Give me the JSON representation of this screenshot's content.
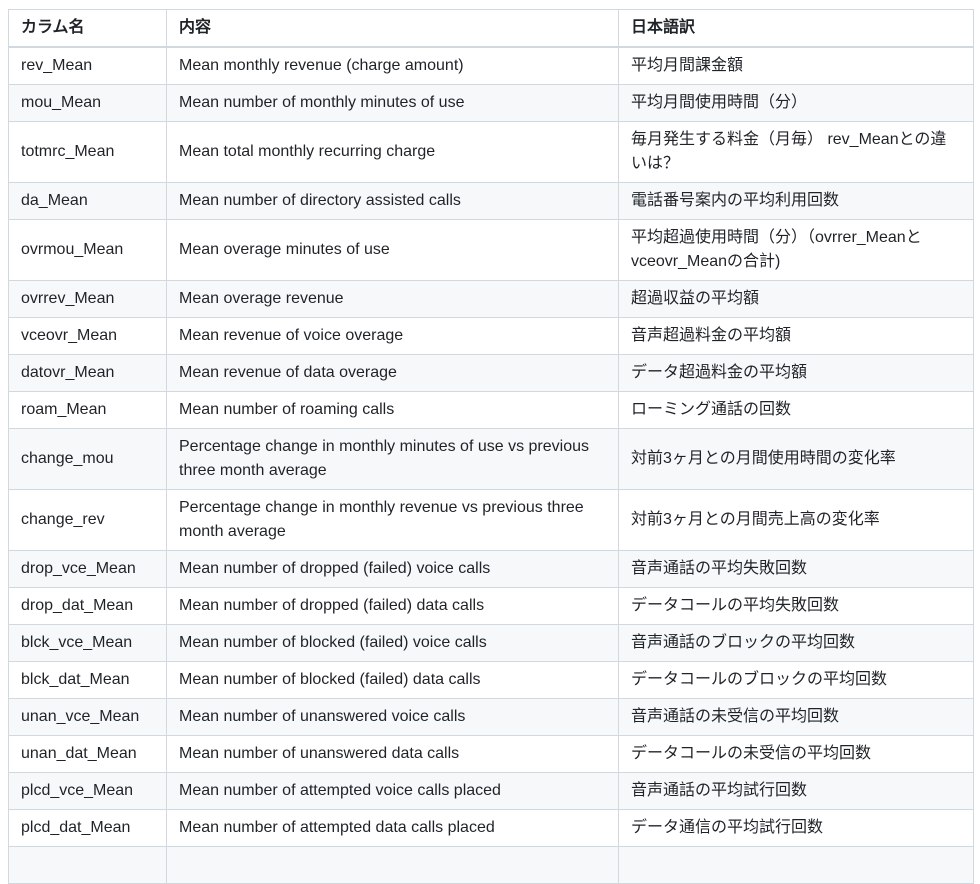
{
  "table": {
    "headers": [
      "カラム名",
      "内容",
      "日本語訳"
    ],
    "rows": [
      [
        "rev_Mean",
        "Mean monthly revenue (charge amount)",
        "平均月間課金額"
      ],
      [
        "mou_Mean",
        "Mean number of monthly minutes of use",
        "平均月間使用時間（分）"
      ],
      [
        "totmrc_Mean",
        "Mean total monthly recurring charge",
        "毎月発生する料金（月毎） rev_Meanとの違いは？"
      ],
      [
        "da_Mean",
        "Mean number of directory assisted calls",
        "電話番号案内の平均利用回数"
      ],
      [
        "ovrmou_Mean",
        "Mean overage minutes of use",
        "平均超過使用時間（分）（ovrrer_Meanとvceovr_Meanの合計)"
      ],
      [
        "ovrrev_Mean",
        "Mean overage revenue",
        "超過収益の平均額"
      ],
      [
        "vceovr_Mean",
        "Mean revenue of voice overage",
        "音声超過料金の平均額"
      ],
      [
        "datovr_Mean",
        "Mean revenue of data overage",
        "データ超過料金の平均額"
      ],
      [
        "roam_Mean",
        "Mean number of roaming calls",
        "ローミング通話の回数"
      ],
      [
        "change_mou",
        "Percentage change in monthly minutes of use vs previous three month average",
        "対前3ヶ月との月間使用時間の変化率"
      ],
      [
        "change_rev",
        "Percentage change in monthly revenue vs previous three month average",
        "対前3ヶ月との月間売上高の変化率"
      ],
      [
        "drop_vce_Mean",
        "Mean number of dropped (failed) voice calls",
        "音声通話の平均失敗回数"
      ],
      [
        "drop_dat_Mean",
        "Mean number of dropped (failed) data calls",
        "データコールの平均失敗回数"
      ],
      [
        "blck_vce_Mean",
        "Mean number of blocked (failed) voice calls",
        "音声通話のブロックの平均回数"
      ],
      [
        "blck_dat_Mean",
        "Mean number of blocked (failed) data calls",
        "データコールのブロックの平均回数"
      ],
      [
        "unan_vce_Mean",
        "Mean number of unanswered voice calls",
        "音声通話の未受信の平均回数"
      ],
      [
        "unan_dat_Mean",
        "Mean number of unanswered data calls",
        "データコールの未受信の平均回数"
      ],
      [
        "plcd_vce_Mean",
        "Mean number of attempted voice calls placed",
        "音声通話の平均試行回数"
      ],
      [
        "plcd_dat_Mean",
        "Mean number of attempted data calls placed",
        "データ通信の平均試行回数"
      ]
    ]
  }
}
